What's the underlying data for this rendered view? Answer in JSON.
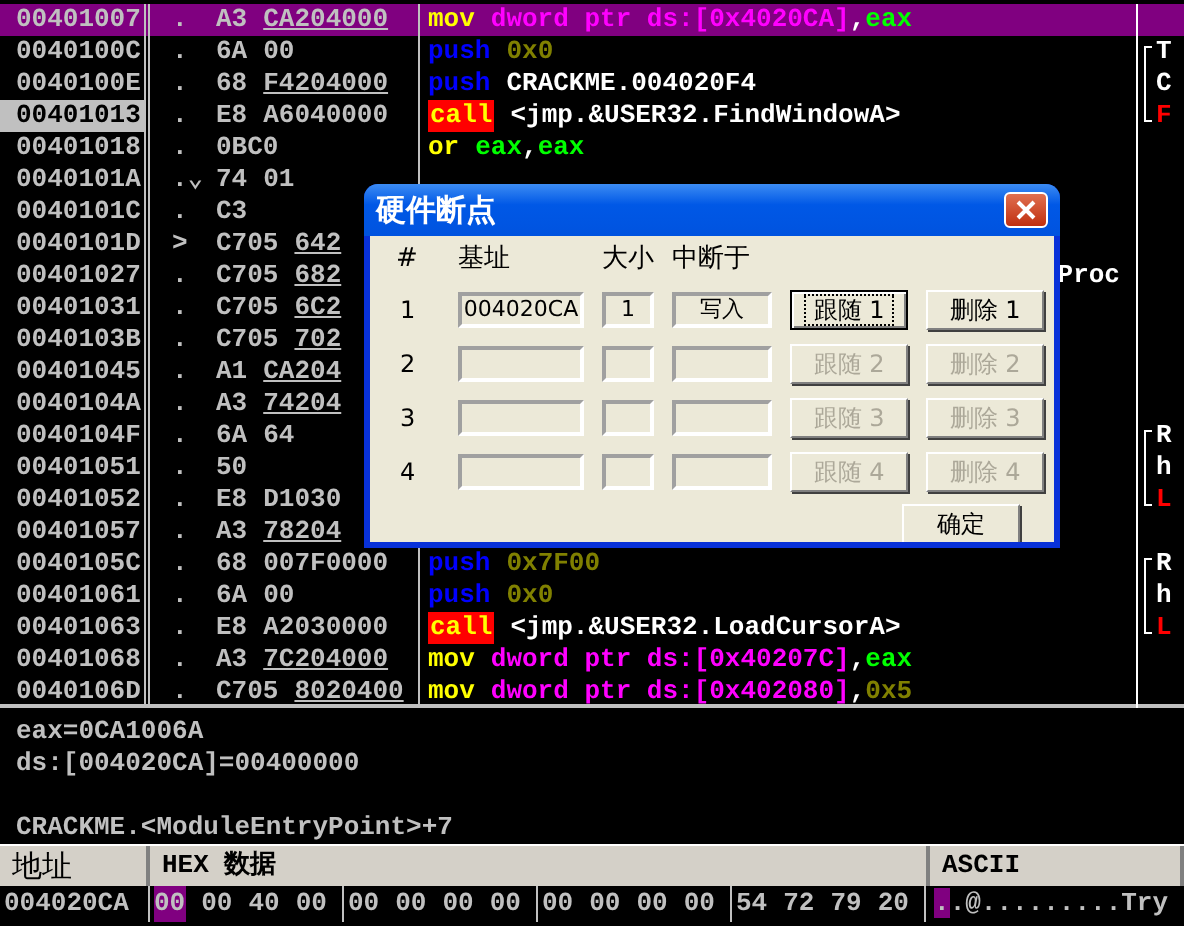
{
  "disassembly": {
    "rows": [
      {
        "address": "00401007",
        "marker": ".",
        "opcode": "A3",
        "operand": "CA204000",
        "fixup": true,
        "selected": true,
        "current": false,
        "disasm": [
          {
            "text": "mov",
            "kind": "mov"
          },
          {
            "text": "dword ptr ds:[0x4020CA]",
            "kind": "mem"
          },
          {
            "text": ",",
            "kind": "punct"
          },
          {
            "text": "eax",
            "kind": "reg"
          }
        ]
      },
      {
        "address": "0040100C",
        "marker": ".",
        "opcode": "6A",
        "operand": "00",
        "fixup": false,
        "selected": false,
        "current": false,
        "disasm": [
          {
            "text": "push",
            "kind": "push"
          },
          {
            "text": "0x0",
            "kind": "imm"
          }
        ],
        "comment": {
          "text": "T",
          "alert": false
        }
      },
      {
        "address": "0040100E",
        "marker": ".",
        "opcode": "68",
        "operand": "F4204000",
        "fixup": true,
        "selected": false,
        "current": false,
        "disasm": [
          {
            "text": "push",
            "kind": "push"
          },
          {
            "text": "CRACKME.004020F4",
            "kind": "sym"
          }
        ],
        "comment": {
          "text": "C",
          "alert": false
        }
      },
      {
        "address": "00401013",
        "marker": ".",
        "opcode": "E8",
        "operand": "A6040000",
        "fixup": false,
        "selected": false,
        "current": true,
        "disasm": [
          {
            "text": "call",
            "kind": "call"
          },
          {
            "text": "<jmp.&USER32.FindWindowA>",
            "kind": "sym"
          }
        ],
        "comment": {
          "text": "F",
          "alert": true
        }
      },
      {
        "address": "00401018",
        "marker": ".",
        "opcode": "0BC0",
        "selected": false,
        "current": false,
        "disasm": [
          {
            "text": "or",
            "kind": "mov"
          },
          {
            "text": "eax",
            "kind": "reg"
          },
          {
            "text": ",",
            "kind": "punct"
          },
          {
            "text": "eax",
            "kind": "reg"
          }
        ]
      },
      {
        "address": "0040101A",
        "marker": ".⌄",
        "opcode": "74",
        "operand": "01",
        "fixup": false,
        "selected": false,
        "current": false
      },
      {
        "address": "0040101C",
        "marker": ".",
        "opcode": "C3",
        "selected": false,
        "current": false
      },
      {
        "address": "0040101D",
        "marker": ">",
        "opcode": "C705",
        "operand": "642",
        "fixup": true,
        "selected": false,
        "current": false
      },
      {
        "address": "00401027",
        "marker": ".",
        "opcode": "C705",
        "operand": "682",
        "fixup": true,
        "selected": false,
        "current": false,
        "tail": "Proc"
      },
      {
        "address": "00401031",
        "marker": ".",
        "opcode": "C705",
        "operand": "6C2",
        "fixup": true,
        "selected": false,
        "current": false
      },
      {
        "address": "0040103B",
        "marker": ".",
        "opcode": "C705",
        "operand": "702",
        "fixup": true,
        "selected": false,
        "current": false
      },
      {
        "address": "00401045",
        "marker": ".",
        "opcode": "A1",
        "operand": "CA204",
        "fixup": true,
        "selected": false,
        "current": false
      },
      {
        "address": "0040104A",
        "marker": ".",
        "opcode": "A3",
        "operand": "74204",
        "fixup": true,
        "selected": false,
        "current": false
      },
      {
        "address": "0040104F",
        "marker": ".",
        "opcode": "6A",
        "operand": "64",
        "fixup": false,
        "selected": false,
        "current": false,
        "comment": {
          "text": "R",
          "alert": false
        }
      },
      {
        "address": "00401051",
        "marker": ".",
        "opcode": "50",
        "selected": false,
        "current": false,
        "comment": {
          "text": "h",
          "alert": false
        }
      },
      {
        "address": "00401052",
        "marker": ".",
        "opcode": "E8",
        "operand": "D1030",
        "fixup": false,
        "selected": false,
        "current": false,
        "comment": {
          "text": "L",
          "alert": true
        }
      },
      {
        "address": "00401057",
        "marker": ".",
        "opcode": "A3",
        "operand": "78204",
        "fixup": true,
        "selected": false,
        "current": false
      },
      {
        "address": "0040105C",
        "marker": ".",
        "opcode": "68",
        "operand": "007F0000",
        "fixup": false,
        "selected": false,
        "current": false,
        "disasm": [
          {
            "text": "push",
            "kind": "push"
          },
          {
            "text": "0x7F00",
            "kind": "imm"
          }
        ],
        "comment": {
          "text": "R",
          "alert": false
        }
      },
      {
        "address": "00401061",
        "marker": ".",
        "opcode": "6A",
        "operand": "00",
        "fixup": false,
        "selected": false,
        "current": false,
        "disasm": [
          {
            "text": "push",
            "kind": "push"
          },
          {
            "text": "0x0",
            "kind": "imm"
          }
        ],
        "comment": {
          "text": "h",
          "alert": false
        }
      },
      {
        "address": "00401063",
        "marker": ".",
        "opcode": "E8",
        "operand": "A2030000",
        "fixup": false,
        "selected": false,
        "current": false,
        "disasm": [
          {
            "text": "call",
            "kind": "call"
          },
          {
            "text": "<jmp.&USER32.LoadCursorA>",
            "kind": "sym"
          }
        ],
        "comment": {
          "text": "L",
          "alert": true
        }
      },
      {
        "address": "00401068",
        "marker": ".",
        "opcode": "A3",
        "operand": "7C204000",
        "fixup": true,
        "selected": false,
        "current": false,
        "disasm": [
          {
            "text": "mov",
            "kind": "mov"
          },
          {
            "text": "dword ptr ds:[0x40207C]",
            "kind": "mem"
          },
          {
            "text": ",",
            "kind": "punct"
          },
          {
            "text": "eax",
            "kind": "reg"
          }
        ]
      },
      {
        "address": "0040106D",
        "marker": ".",
        "opcode": "C705",
        "operand": "8020400",
        "fixup": true,
        "selected": false,
        "current": false,
        "disasm": [
          {
            "text": "mov",
            "kind": "mov"
          },
          {
            "text": "dword ptr ds:[0x402080]",
            "kind": "mem"
          },
          {
            "text": ",",
            "kind": "punct"
          },
          {
            "text": "0x5",
            "kind": "imm"
          }
        ]
      }
    ]
  },
  "info": {
    "paragraphs": [
      [
        "eax=0CA1006A",
        "ds:[004020CA]=00400000"
      ],
      [
        "CRACKME.<ModuleEntryPoint>+7"
      ]
    ]
  },
  "dump": {
    "columns": [
      "地址",
      "HEX 数据",
      "ASCII"
    ],
    "address": "004020CA",
    "bytes": [
      {
        "text": "00",
        "selected": true
      },
      {
        "text": "00",
        "selected": false
      },
      {
        "text": "40",
        "selected": false
      },
      {
        "text": "00",
        "selected": false
      },
      {
        "text": "00",
        "selected": false
      },
      {
        "text": "00",
        "selected": false
      },
      {
        "text": "00",
        "selected": false
      },
      {
        "text": "00",
        "selected": false
      },
      {
        "text": "00",
        "selected": false
      },
      {
        "text": "00",
        "selected": false
      },
      {
        "text": "00",
        "selected": false
      },
      {
        "text": "00",
        "selected": false
      },
      {
        "text": "54",
        "selected": false
      },
      {
        "text": "72",
        "selected": false
      },
      {
        "text": "79",
        "selected": false
      },
      {
        "text": "20",
        "selected": false
      }
    ],
    "ascii": [
      {
        "text": ".",
        "selected": true
      },
      {
        "text": ".@.........Try",
        "selected": false
      }
    ]
  },
  "dialog": {
    "title": "硬件断点",
    "headers": [
      "#",
      "基址",
      "大小",
      "中断于"
    ],
    "rows": [
      {
        "index": "1",
        "address": "004020CA",
        "size": "1",
        "type": "写入",
        "follow": "跟随 1",
        "delete": "删除 1",
        "disabled": false,
        "focused": true
      },
      {
        "index": "2",
        "follow": "跟随 2",
        "delete": "删除 2",
        "disabled": true,
        "focused": false
      },
      {
        "index": "3",
        "follow": "跟随 3",
        "delete": "删除 3",
        "disabled": true,
        "focused": false
      },
      {
        "index": "4",
        "follow": "跟随 4",
        "delete": "删除 4",
        "disabled": true,
        "focused": false
      }
    ],
    "ok": "确定"
  }
}
